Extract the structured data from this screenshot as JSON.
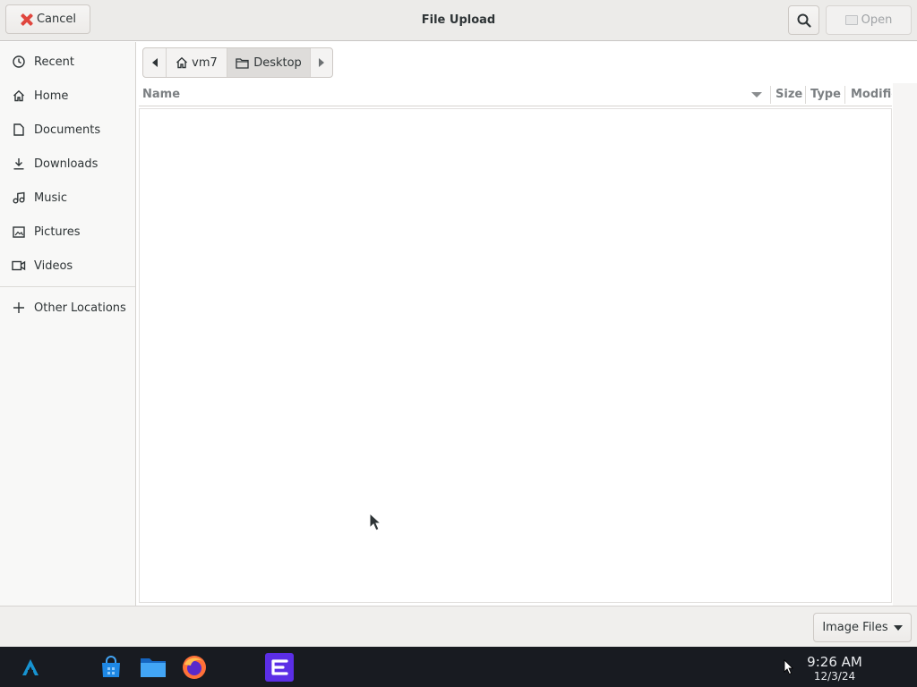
{
  "dialog": {
    "title": "File Upload",
    "cancel_label": "Cancel",
    "open_label": "Open",
    "search_icon": "search-icon"
  },
  "sidebar": {
    "items": [
      {
        "label": "Recent",
        "icon": "clock-icon"
      },
      {
        "label": "Home",
        "icon": "home-icon"
      },
      {
        "label": "Documents",
        "icon": "document-icon"
      },
      {
        "label": "Downloads",
        "icon": "download-icon"
      },
      {
        "label": "Music",
        "icon": "music-icon"
      },
      {
        "label": "Pictures",
        "icon": "picture-icon"
      },
      {
        "label": "Videos",
        "icon": "video-icon"
      }
    ],
    "other_locations": {
      "label": "Other Locations",
      "icon": "plus-icon"
    }
  },
  "pathbar": {
    "segments": [
      {
        "label": "vm7",
        "icon": "home-icon"
      },
      {
        "label": "Desktop",
        "icon": "folder-icon",
        "active": true
      }
    ]
  },
  "file_list": {
    "columns": [
      "Name",
      "Size",
      "Type",
      "Modified"
    ],
    "sort_column": "Name",
    "rows": []
  },
  "footer": {
    "filter_label": "Image Files"
  },
  "taskbar": {
    "apps": [
      "app-launcher-icon",
      "software-store-icon",
      "file-manager-icon",
      "firefox-icon",
      "code-editor-icon"
    ],
    "time": "9:26 AM",
    "date": "12/3/24"
  },
  "colors": {
    "accent_red": "#e0463e",
    "taskbar_bg": "#181b21",
    "header_bg": "#ecebe9"
  }
}
